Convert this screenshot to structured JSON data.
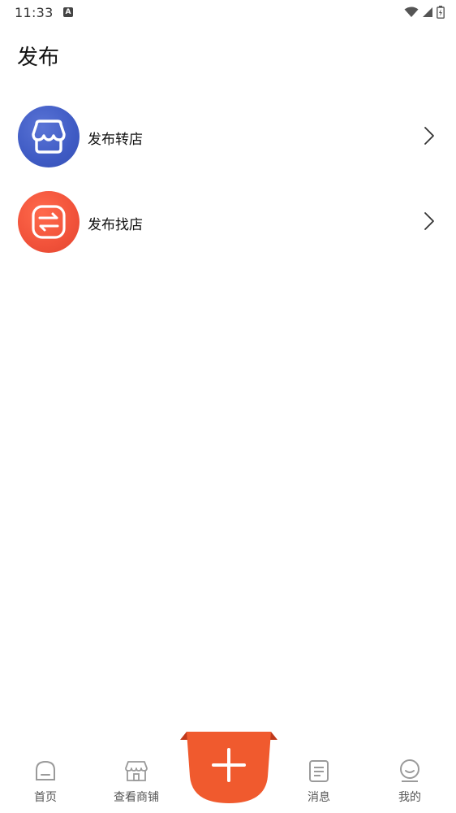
{
  "status_bar": {
    "time": "11:33",
    "notification_letter": "A"
  },
  "header": {
    "title": "发布"
  },
  "list": {
    "items": [
      {
        "label": "发布转店",
        "icon": "storefront-icon",
        "color": "#3f5bc4"
      },
      {
        "label": "发布找店",
        "icon": "swap-arrows-icon",
        "color": "#f1523a"
      }
    ]
  },
  "tabbar": {
    "tabs": [
      {
        "label": "首页",
        "icon": "home-icon"
      },
      {
        "label": "查看商铺",
        "icon": "shop-icon"
      },
      {
        "label": "",
        "icon": "plus-icon",
        "accent": "#f05a2e"
      },
      {
        "label": "消息",
        "icon": "message-icon"
      },
      {
        "label": "我的",
        "icon": "profile-icon"
      }
    ]
  }
}
